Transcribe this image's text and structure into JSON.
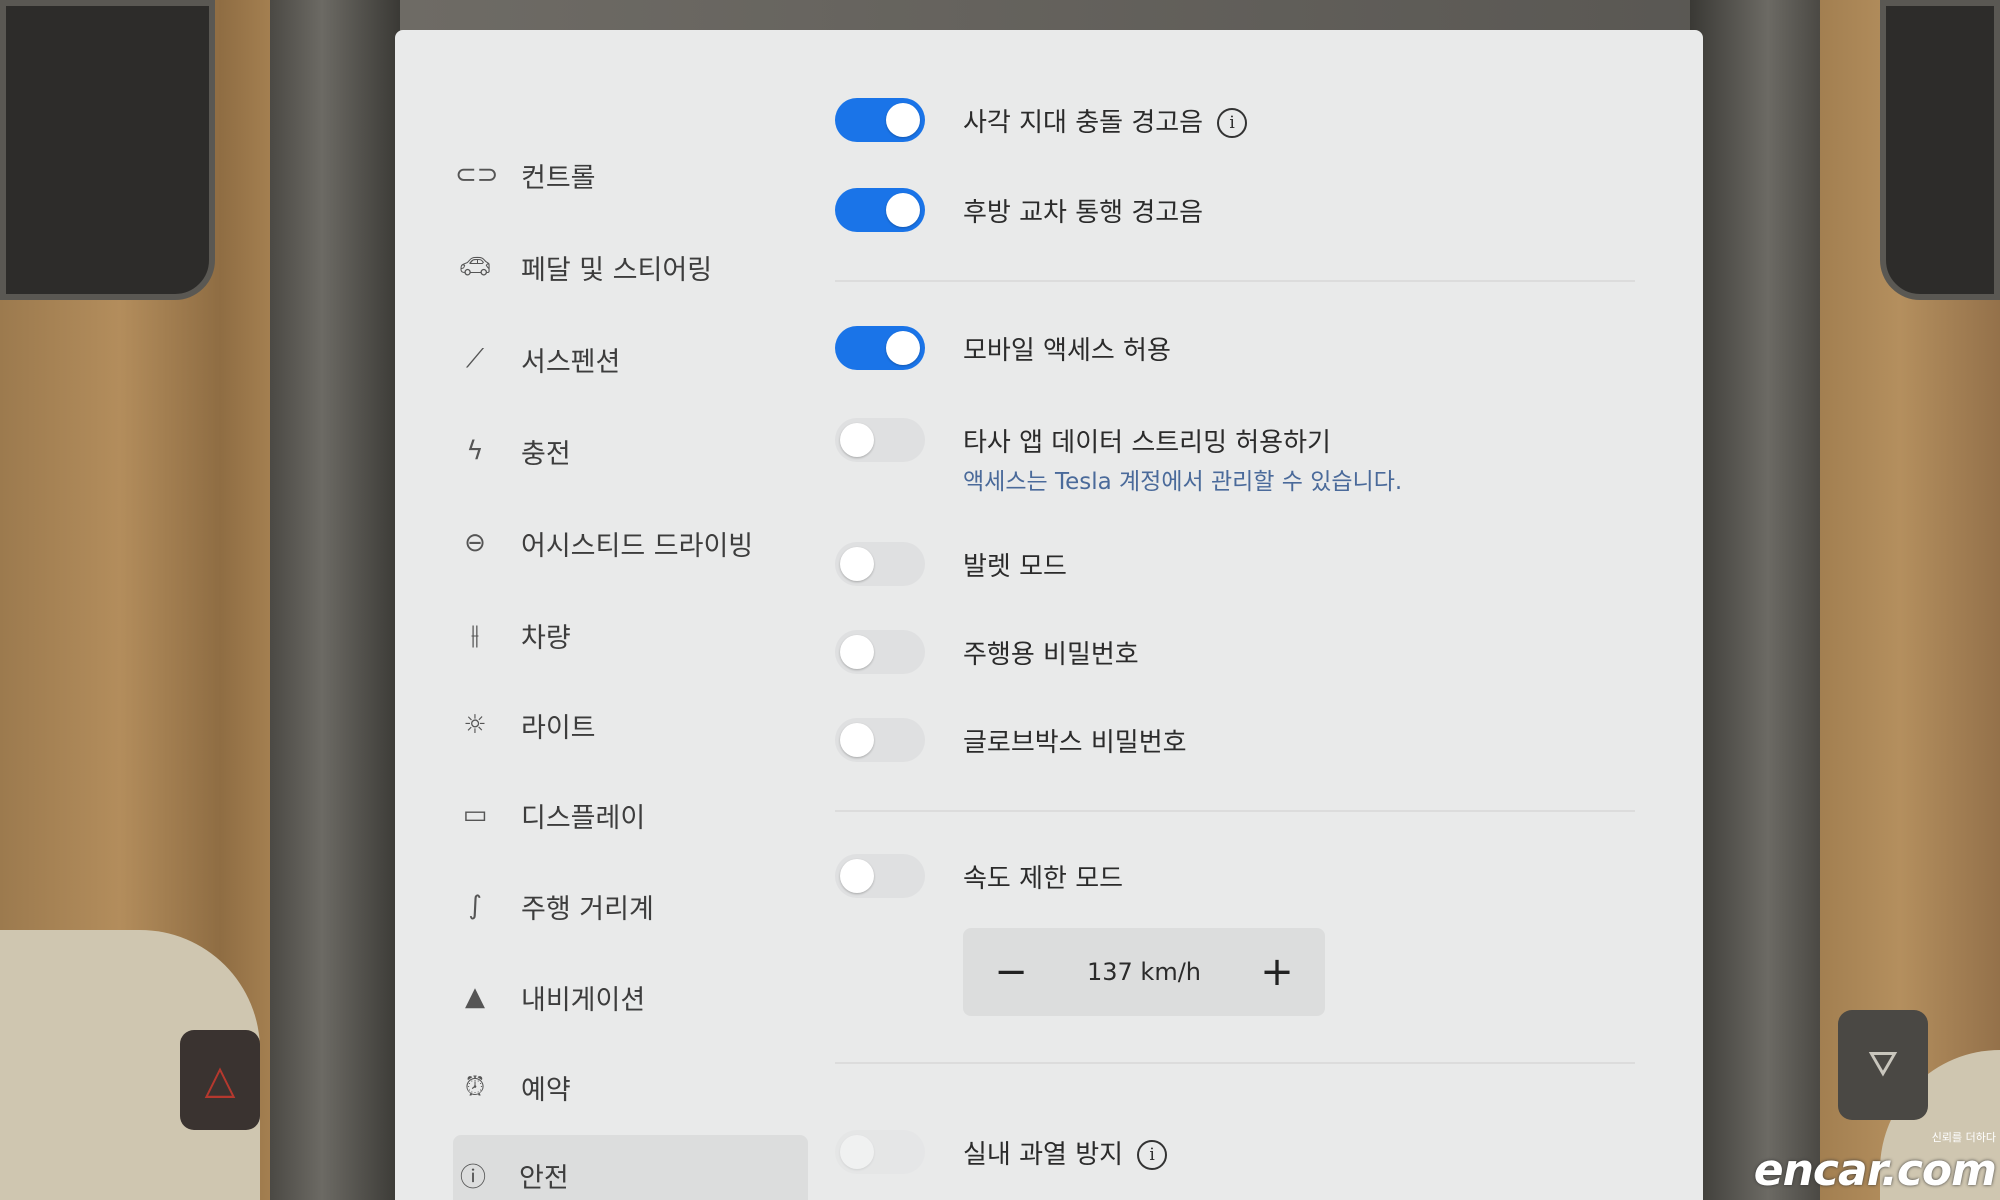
{
  "sidebar": {
    "items": [
      {
        "label": "컨트롤",
        "icon": "toggle-icon"
      },
      {
        "label": "페달 및 스티어링",
        "icon": "car-icon"
      },
      {
        "label": "서스펜션",
        "icon": "wrench-icon"
      },
      {
        "label": "충전",
        "icon": "lightning-icon"
      },
      {
        "label": "어시스티드 드라이빙",
        "icon": "steering-wheel-icon"
      },
      {
        "label": "차량",
        "icon": "sliders-icon"
      },
      {
        "label": "라이트",
        "icon": "sun-icon"
      },
      {
        "label": "디스플레이",
        "icon": "display-icon"
      },
      {
        "label": "주행 거리계",
        "icon": "trip-icon"
      },
      {
        "label": "내비게이션",
        "icon": "navigation-arrow-icon"
      },
      {
        "label": "예약",
        "icon": "alarm-clock-icon"
      },
      {
        "label": "안전",
        "icon": "alert-circle-icon"
      }
    ],
    "active": "안전"
  },
  "settings": {
    "blind_spot": {
      "label": "사각 지대 충돌 경고음",
      "on": true
    },
    "rear_cross": {
      "label": "후방 교차 통행 경고음",
      "on": true
    },
    "mobile_access": {
      "label": "모바일 액세스 허용",
      "on": true
    },
    "third_party": {
      "label": "타사 앱 데이터 스트리밍 허용하기",
      "sub": "액세스는 Tesla 계정에서 관리할 수 있습니다.",
      "on": false
    },
    "valet": {
      "label": "발렛 모드",
      "on": false
    },
    "pin_to_drive": {
      "label": "주행용 비밀번호",
      "on": false
    },
    "glovebox_pin": {
      "label": "글로브박스 비밀번호",
      "on": false
    },
    "speed_limit": {
      "label": "속도 제한 모드",
      "on": false,
      "value": "137 km/h",
      "minus": "−",
      "plus": "+"
    },
    "cabin_overheat": {
      "label": "실내 과열 방지"
    }
  },
  "watermark": {
    "tag": "신뢰를 더하다",
    "logo": "encar.com"
  },
  "colors": {
    "toggle_on": "#1a74e8",
    "screen_bg": "#e9eaea"
  }
}
